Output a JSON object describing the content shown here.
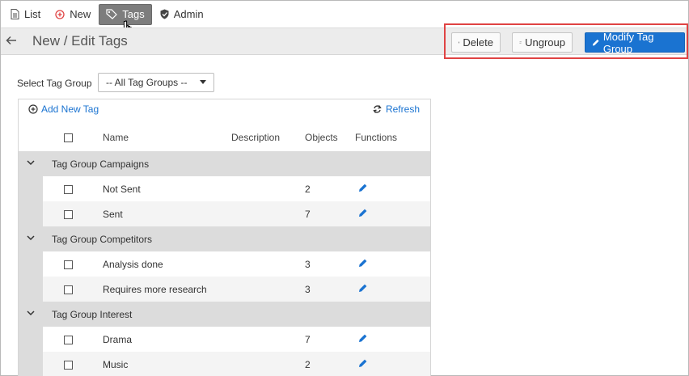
{
  "nav": {
    "list_label": "List",
    "new_label": "New",
    "tags_label": "Tags",
    "admin_label": "Admin"
  },
  "header": {
    "title": "New / Edit Tags",
    "delete_label": "Delete",
    "ungroup_label": "Ungroup",
    "modify_label": "Modify Tag Group"
  },
  "filter": {
    "label": "Select Tag Group",
    "selected": "-- All Tag Groups --"
  },
  "toolbar": {
    "add_label": "Add New Tag",
    "refresh_label": "Refresh"
  },
  "columns": {
    "name": "Name",
    "description": "Description",
    "objects": "Objects",
    "functions": "Functions"
  },
  "groups": [
    {
      "label": "Tag Group Campaigns",
      "tags": [
        {
          "name": "Not Sent",
          "objects": "2"
        },
        {
          "name": "Sent",
          "objects": "7"
        }
      ]
    },
    {
      "label": "Tag Group Competitors",
      "tags": [
        {
          "name": "Analysis done",
          "objects": "3"
        },
        {
          "name": "Requires more research",
          "objects": "3"
        }
      ]
    },
    {
      "label": "Tag Group Interest",
      "tags": [
        {
          "name": "Drama",
          "objects": "7"
        },
        {
          "name": "Music",
          "objects": "2"
        }
      ]
    }
  ],
  "colors": {
    "accent": "#1a73d1",
    "highlight": "#e04343",
    "active_nav": "#7d7d7d",
    "group_row": "#dcdcdc"
  },
  "icons": {
    "list": "document-icon",
    "new": "plus-circle-icon",
    "tags": "tag-icon",
    "admin": "shield-check-icon",
    "back": "arrow-left-icon",
    "delete": "trash-icon",
    "ungroup": "ungroup-icon",
    "modify": "pencil-icon",
    "add": "plus-circle-icon",
    "refresh": "refresh-icon",
    "edit": "pencil-icon",
    "group_toggle": "chevron-down-icon"
  }
}
